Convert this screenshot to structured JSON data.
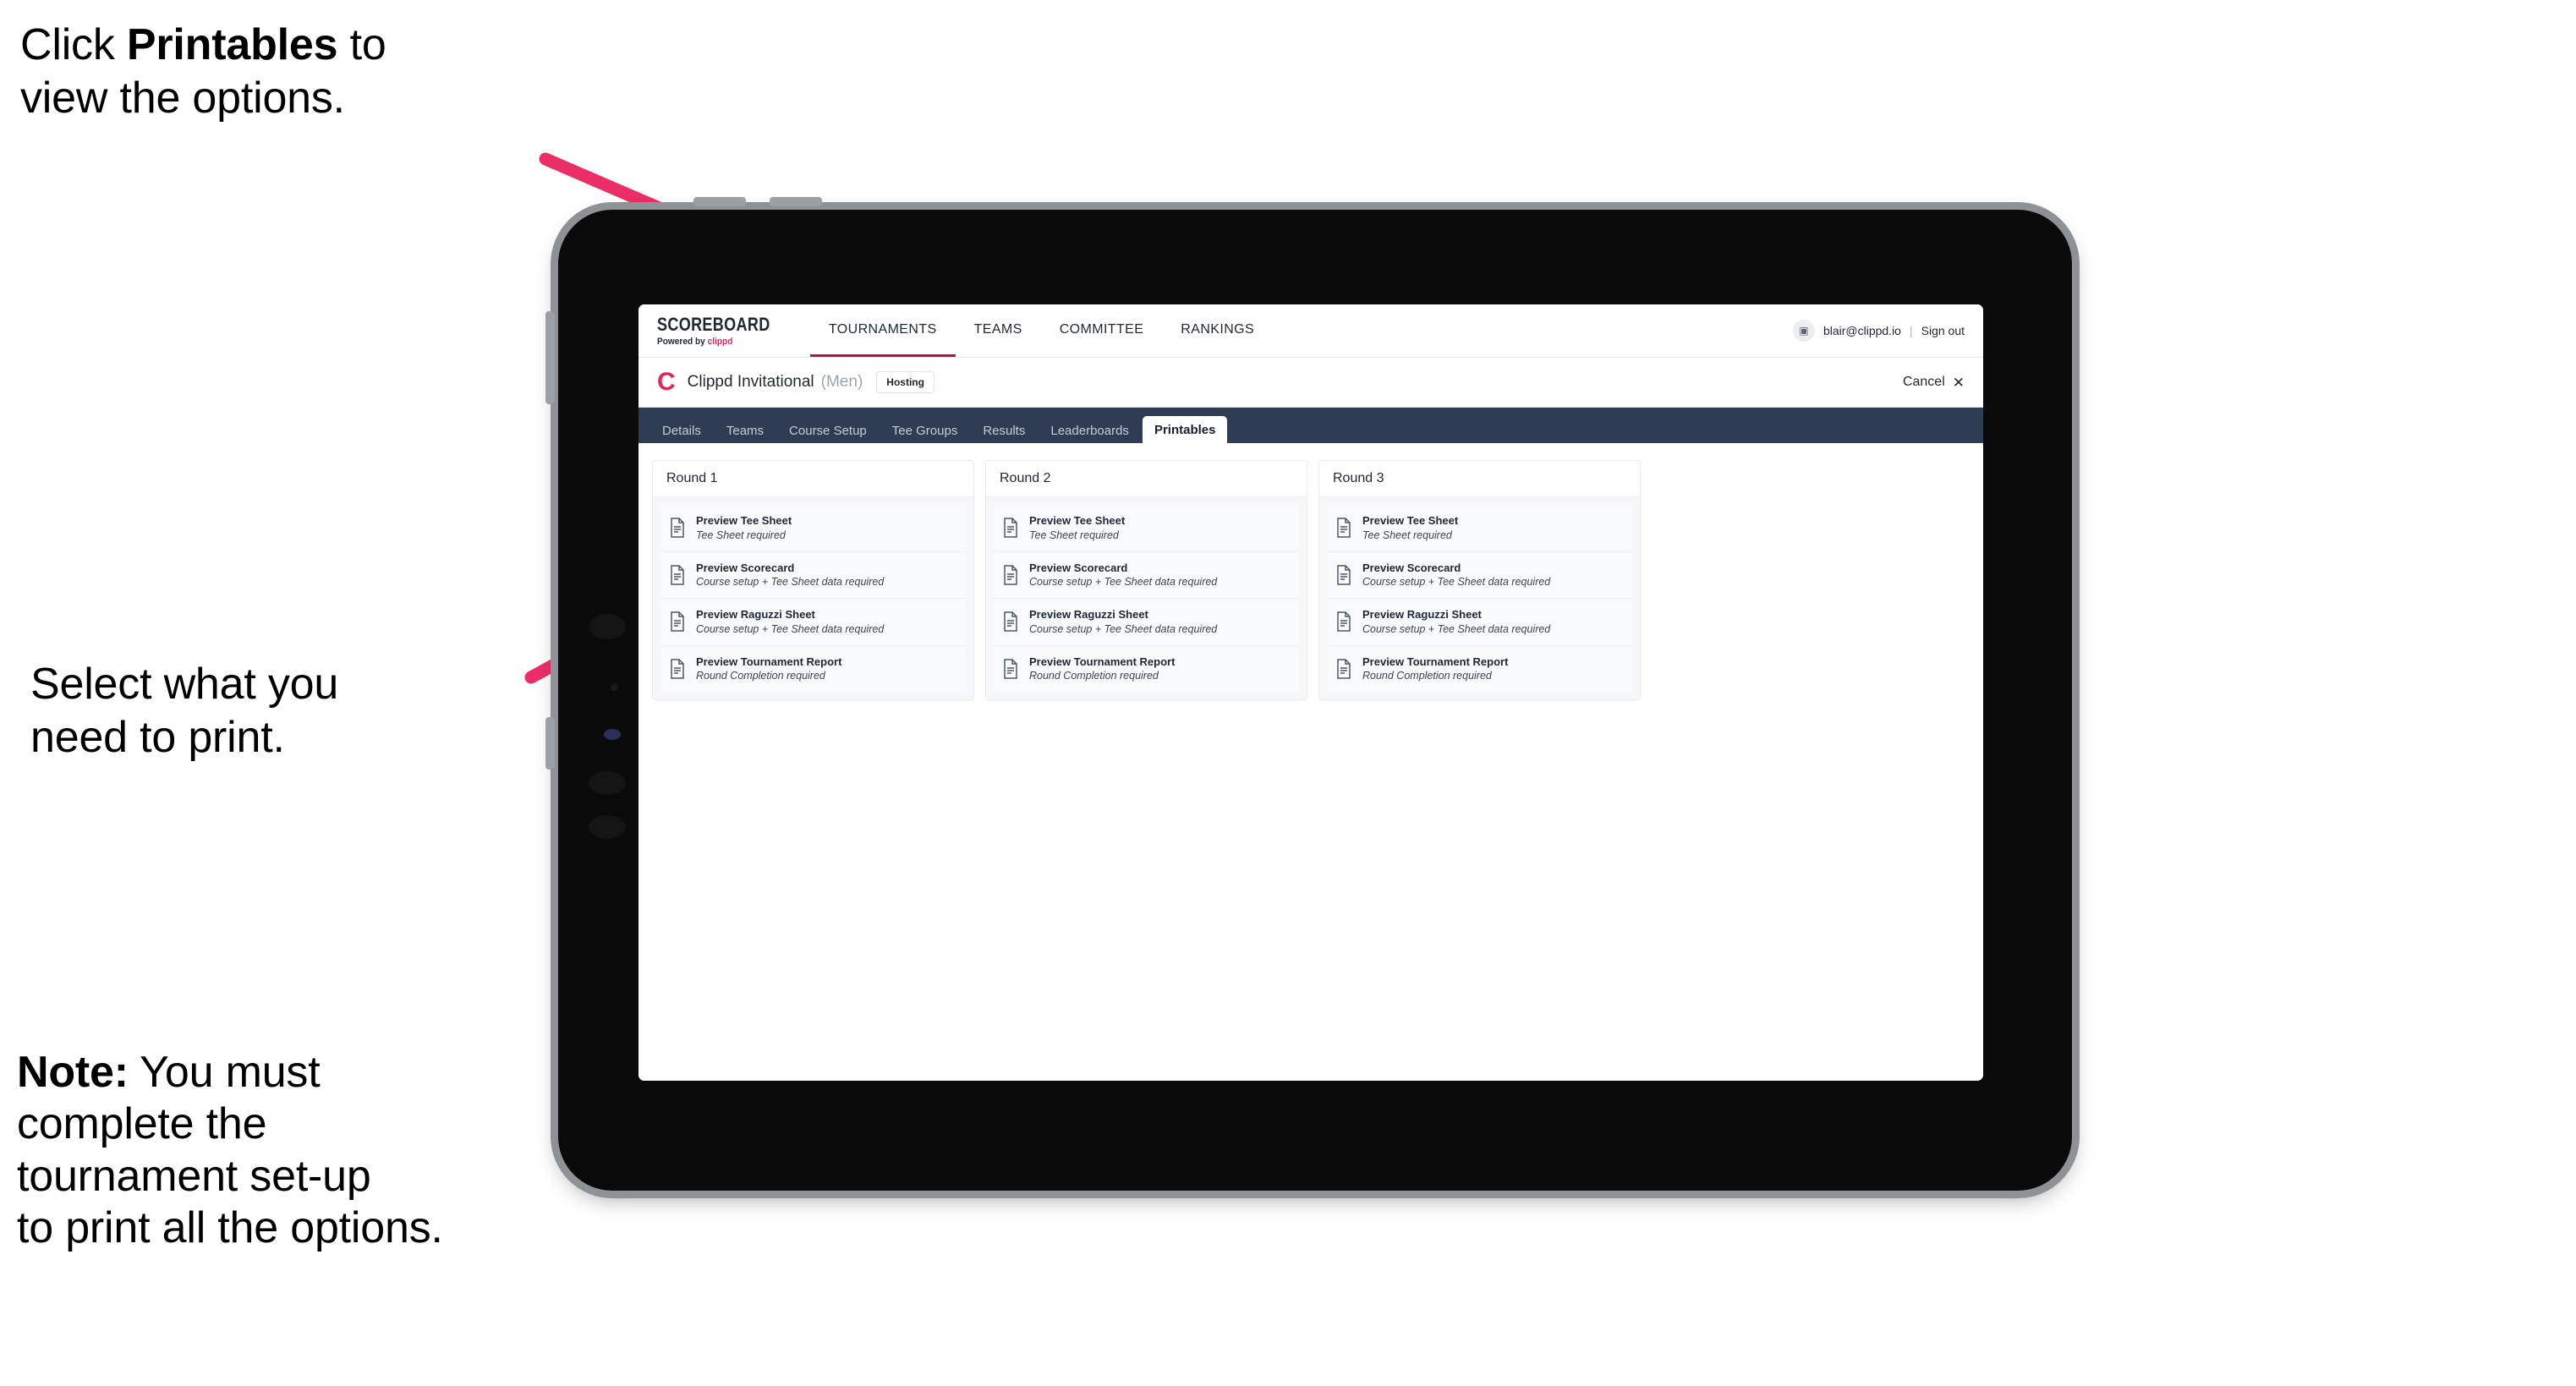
{
  "annotations": {
    "top": "Click **Printables** to\nview the options.",
    "top_plain_1": "Click ",
    "top_bold": "Printables",
    "top_plain_2": " to\nview the options.",
    "middle": "Select what you\n need to print.",
    "note_bold": "Note:",
    "note_rest": " You must\ncomplete the\ntournament set-up\nto print all the options."
  },
  "app": {
    "brand": {
      "name": "SCOREBOARD",
      "powered_prefix": "Powered by ",
      "powered_brand": "clippd"
    },
    "top_nav": [
      {
        "label": "TOURNAMENTS",
        "active": true
      },
      {
        "label": "TEAMS",
        "active": false
      },
      {
        "label": "COMMITTEE",
        "active": false
      },
      {
        "label": "RANKINGS",
        "active": false
      }
    ],
    "account": {
      "avatar_glyph": "▣",
      "email": "blair@clippd.io",
      "separator": "|",
      "sign_out": "Sign out"
    },
    "tournament_bar": {
      "logo_letter": "C",
      "title": "Clippd Invitational",
      "gender": "(Men)",
      "status_chip": "Hosting",
      "cancel_label": "Cancel",
      "cancel_icon": "✕"
    },
    "tabs": [
      {
        "label": "Details",
        "active": false
      },
      {
        "label": "Teams",
        "active": false
      },
      {
        "label": "Course Setup",
        "active": false
      },
      {
        "label": "Tee Groups",
        "active": false
      },
      {
        "label": "Results",
        "active": false
      },
      {
        "label": "Leaderboards",
        "active": false
      },
      {
        "label": "Printables",
        "active": true
      }
    ],
    "rounds": [
      {
        "heading": "Round 1",
        "items": [
          {
            "title": "Preview Tee Sheet",
            "requirement": "Tee Sheet required"
          },
          {
            "title": "Preview Scorecard",
            "requirement": "Course setup + Tee Sheet data required"
          },
          {
            "title": "Preview Raguzzi Sheet",
            "requirement": "Course setup + Tee Sheet data required"
          },
          {
            "title": "Preview Tournament Report",
            "requirement": "Round Completion required"
          }
        ]
      },
      {
        "heading": "Round 2",
        "items": [
          {
            "title": "Preview Tee Sheet",
            "requirement": "Tee Sheet required"
          },
          {
            "title": "Preview Scorecard",
            "requirement": "Course setup + Tee Sheet data required"
          },
          {
            "title": "Preview Raguzzi Sheet",
            "requirement": "Course setup + Tee Sheet data required"
          },
          {
            "title": "Preview Tournament Report",
            "requirement": "Round Completion required"
          }
        ]
      },
      {
        "heading": "Round 3",
        "items": [
          {
            "title": "Preview Tee Sheet",
            "requirement": "Tee Sheet required"
          },
          {
            "title": "Preview Scorecard",
            "requirement": "Course setup + Tee Sheet data required"
          },
          {
            "title": "Preview Raguzzi Sheet",
            "requirement": "Course setup + Tee Sheet data required"
          },
          {
            "title": "Preview Tournament Report",
            "requirement": "Round Completion required"
          }
        ]
      }
    ]
  },
  "colors": {
    "accent_pink": "#ec2e66",
    "brand_crimson": "#e0275e",
    "navbar_dark": "#2e3c54",
    "active_underline": "#b7134c",
    "device_body": "#0a0a0a",
    "device_bezel": "#8e9195"
  }
}
